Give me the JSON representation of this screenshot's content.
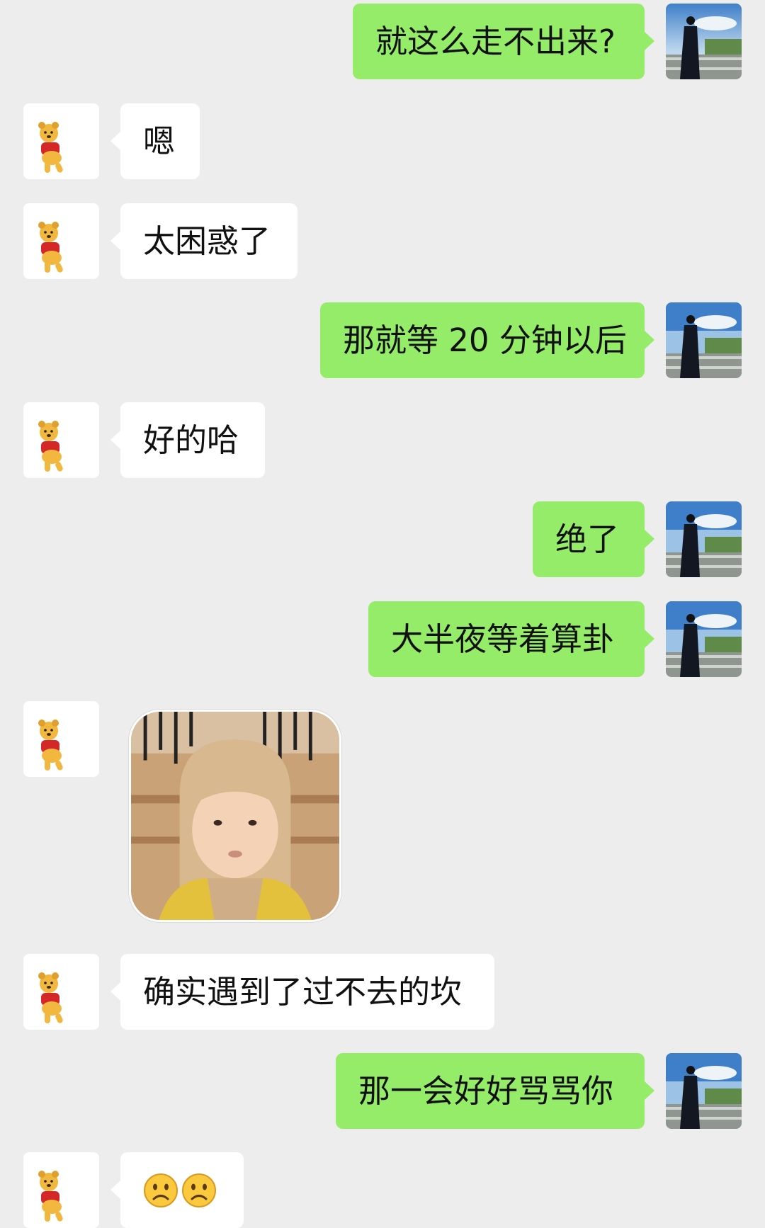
{
  "contacts": {
    "self": {
      "avatar": "man-by-railing-avatar"
    },
    "friend": {
      "avatar": "winnie-the-pooh-avatar"
    }
  },
  "colors": {
    "background": "#ededed",
    "outgoing_bubble": "#95ec69",
    "incoming_bubble": "#ffffff"
  },
  "messages": [
    {
      "side": "out",
      "type": "text",
      "text": "就这么走不出来?"
    },
    {
      "side": "in",
      "type": "text",
      "text": "嗯"
    },
    {
      "side": "in",
      "type": "text",
      "text": "太困惑了"
    },
    {
      "side": "out",
      "type": "text",
      "text": "那就等 20 分钟以后"
    },
    {
      "side": "in",
      "type": "text",
      "text": "好的哈"
    },
    {
      "side": "out",
      "type": "text",
      "text": "绝了"
    },
    {
      "side": "out",
      "type": "text",
      "text": "大半夜等着算卦"
    },
    {
      "side": "in",
      "type": "sticker",
      "sticker": "hooded-baby-sticker"
    },
    {
      "side": "in",
      "type": "text",
      "text": "确实遇到了过不去的坎"
    },
    {
      "side": "out",
      "type": "text",
      "text": "那一会好好骂骂你"
    },
    {
      "side": "in",
      "type": "emoji",
      "emoji": [
        "frowning-face-emoji",
        "frowning-face-emoji"
      ]
    }
  ]
}
